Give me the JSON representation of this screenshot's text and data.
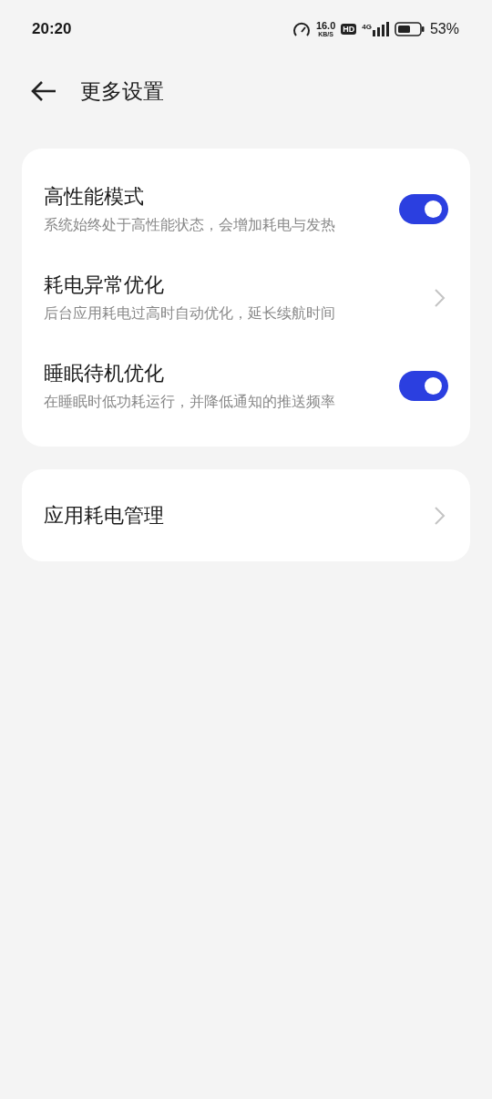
{
  "status_bar": {
    "time": "20:20",
    "speed_value": "16.0",
    "speed_unit": "KB/S",
    "hd_badge": "HD",
    "network": "4G",
    "battery": "53%"
  },
  "header": {
    "title": "更多设置"
  },
  "groups": [
    {
      "items": [
        {
          "kind": "toggle",
          "title": "高性能模式",
          "subtitle": "系统始终处于高性能状态，会增加耗电与发热",
          "on": true
        },
        {
          "kind": "link",
          "title": "耗电异常优化",
          "subtitle": "后台应用耗电过高时自动优化，延长续航时间"
        },
        {
          "kind": "toggle",
          "title": "睡眠待机优化",
          "subtitle": "在睡眠时低功耗运行，并降低通知的推送频率",
          "on": true
        }
      ]
    },
    {
      "items": [
        {
          "kind": "link",
          "title": "应用耗电管理"
        }
      ]
    }
  ]
}
